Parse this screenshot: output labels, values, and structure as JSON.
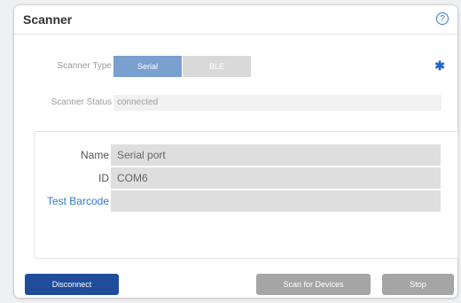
{
  "panel": {
    "title": "Scanner",
    "help_icon": "question-circle-icon"
  },
  "scanner_type": {
    "label": "Scanner Type",
    "options": [
      "Serial",
      "BLE"
    ],
    "selected": "Serial",
    "icon": "bluetooth-icon"
  },
  "scanner_status": {
    "label": "Scanner Status",
    "value": "connected"
  },
  "device": {
    "rows": [
      {
        "label": "Name",
        "value": "Serial port"
      },
      {
        "label": "ID",
        "value": "COM6"
      },
      {
        "label": "Test Barcode",
        "value": ""
      }
    ]
  },
  "buttons": {
    "disconnect": "Disconnect",
    "scan": "Scan for Devices",
    "stop": "Stop"
  },
  "colors": {
    "primary": "#1f4d99",
    "segment_selected": "#7aa0cf",
    "disabled": "#a5a5a5",
    "link": "#2e7bd1"
  }
}
